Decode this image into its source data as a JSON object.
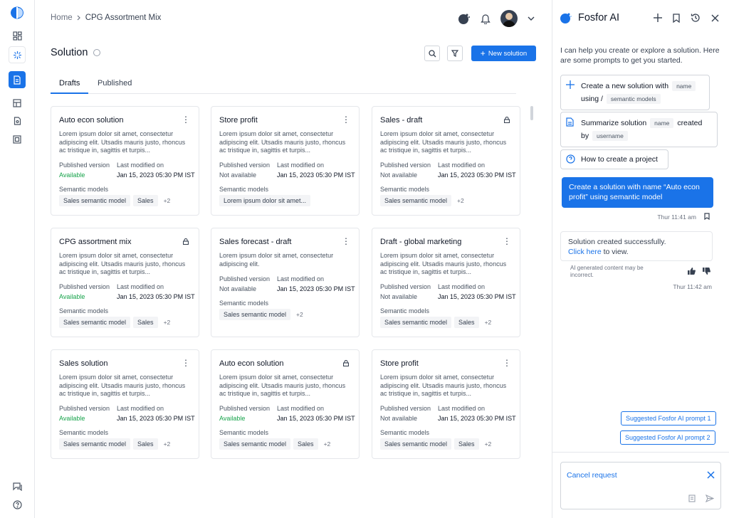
{
  "breadcrumb": {
    "home": "Home",
    "current": "CPG Assortment Mix"
  },
  "page": {
    "title": "Solution",
    "new_button": "New solution"
  },
  "tabs": [
    {
      "label": "Drafts",
      "active": true
    },
    {
      "label": "Published",
      "active": false
    }
  ],
  "labels": {
    "published_version": "Published version",
    "last_modified": "Last modified on",
    "semantic_models": "Semantic models"
  },
  "cards": [
    {
      "title": "Auto econ solution",
      "desc": "Lorem ipsum dolor sit amet, consectetur adipiscing elit. Utsadis mauris justo, rhoncus ac tristique in, sagittis et turpis...",
      "status": "Available",
      "available": true,
      "date": "Jan 15, 2023 05:30 PM IST",
      "chips": [
        "Sales semantic model",
        "Sales"
      ],
      "more": "+2",
      "locked": false
    },
    {
      "title": "Store profit",
      "desc": "Lorem ipsum dolor sit amet, consectetur adipiscing elit. Utsadis mauris justo, rhoncus ac tristique in, sagittis et turpis...",
      "status": "Not available",
      "available": false,
      "date": "Jan 15, 2023 05:30 PM IST",
      "chips": [
        "Lorem ipsum dolor sit amet..."
      ],
      "more": "",
      "locked": false
    },
    {
      "title": "Sales - draft",
      "desc": "Lorem ipsum dolor sit amet, consectetur adipiscing elit. Utsadis mauris justo, rhoncus ac tristique in, sagittis et turpis...",
      "status": "Not available",
      "available": false,
      "date": "Jan 15, 2023 05:30 PM IST",
      "chips": [
        "Sales semantic model"
      ],
      "more": "+2",
      "locked": true
    },
    {
      "title": "CPG assortment mix",
      "desc": "Lorem ipsum dolor sit amet, consectetur adipiscing elit. Utsadis mauris justo, rhoncus ac tristique in, sagittis et turpis...",
      "status": "Available",
      "available": true,
      "date": "Jan 15, 2023 05:30 PM IST",
      "chips": [
        "Sales semantic model",
        "Sales"
      ],
      "more": "+2",
      "locked": true
    },
    {
      "title": "Sales forecast - draft",
      "desc": "Lorem ipsum dolor sit amet, consectetur adipiscing elit.",
      "status": "Not available",
      "available": false,
      "date": "Jan 15, 2023 05:30 PM IST",
      "chips": [
        "Sales semantic model"
      ],
      "more": "+2",
      "locked": false,
      "short": true
    },
    {
      "title": "Draft - global marketing",
      "desc": "Lorem ipsum dolor sit amet, consectetur adipiscing elit. Utsadis mauris justo, rhoncus ac tristique in, sagittis et turpis...",
      "status": "Not available",
      "available": false,
      "date": "Jan 15, 2023 05:30 PM IST",
      "chips": [
        "Sales semantic model",
        "Sales"
      ],
      "more": "+2",
      "locked": false
    },
    {
      "title": "Sales solution",
      "desc": "Lorem ipsum dolor sit amet, consectetur adipiscing elit. Utsadis mauris justo, rhoncus ac tristique in, sagittis et turpis...",
      "status": "Available",
      "available": true,
      "date": "Jan 15, 2023 05:30 PM IST",
      "chips": [
        "Sales semantic model",
        "Sales"
      ],
      "more": "+2",
      "locked": false
    },
    {
      "title": "Auto econ solution",
      "desc": "Lorem ipsum dolor sit amet, consectetur adipiscing elit. Utsadis mauris justo, rhoncus ac tristique in, sagittis et turpis...",
      "status": "Available",
      "available": true,
      "date": "Jan 15, 2023 05:30 PM IST",
      "chips": [
        "Sales semantic model",
        "Sales"
      ],
      "more": "+2",
      "locked": true
    },
    {
      "title": "Store profit",
      "desc": "Lorem ipsum dolor sit amet, consectetur adipiscing elit. Utsadis mauris justo, rhoncus ac tristique in, sagittis et turpis...",
      "status": "Not available",
      "available": false,
      "date": "Jan 15, 2023 05:30 PM IST",
      "chips": [
        "Sales semantic model",
        "Sales"
      ],
      "more": "+2",
      "locked": false
    }
  ],
  "ai": {
    "title": "Fosfor AI",
    "intro": "I can help you create or explore a solution. Here are some prompts to get you started.",
    "p1": {
      "a": "Create a new solution with",
      "tag1": "name",
      "b": "using /",
      "tag2": "semantic models"
    },
    "p2": {
      "a": "Summarize solution",
      "tag1": "name",
      "b": "created",
      "c": "by",
      "tag2": "username"
    },
    "p3": "How to create a project",
    "user_msg": "Create a solution with name “Auto econ profit” using semantic model",
    "user_time": "Thur 11:41 am",
    "reply_a": "Solution created successfully.",
    "reply_link": "Click here",
    "reply_b": " to view.",
    "disclaimer": "AI generated content may be incorrect.",
    "reply_time": "Thur 11:42 am",
    "suggest1": "Suggested Fosfor AI prompt 1",
    "suggest2": "Suggested Fosfor AI prompt 2",
    "cancel": "Cancel request"
  },
  "colors": {
    "accent": "#1a73e8",
    "available": "#16a34a"
  }
}
